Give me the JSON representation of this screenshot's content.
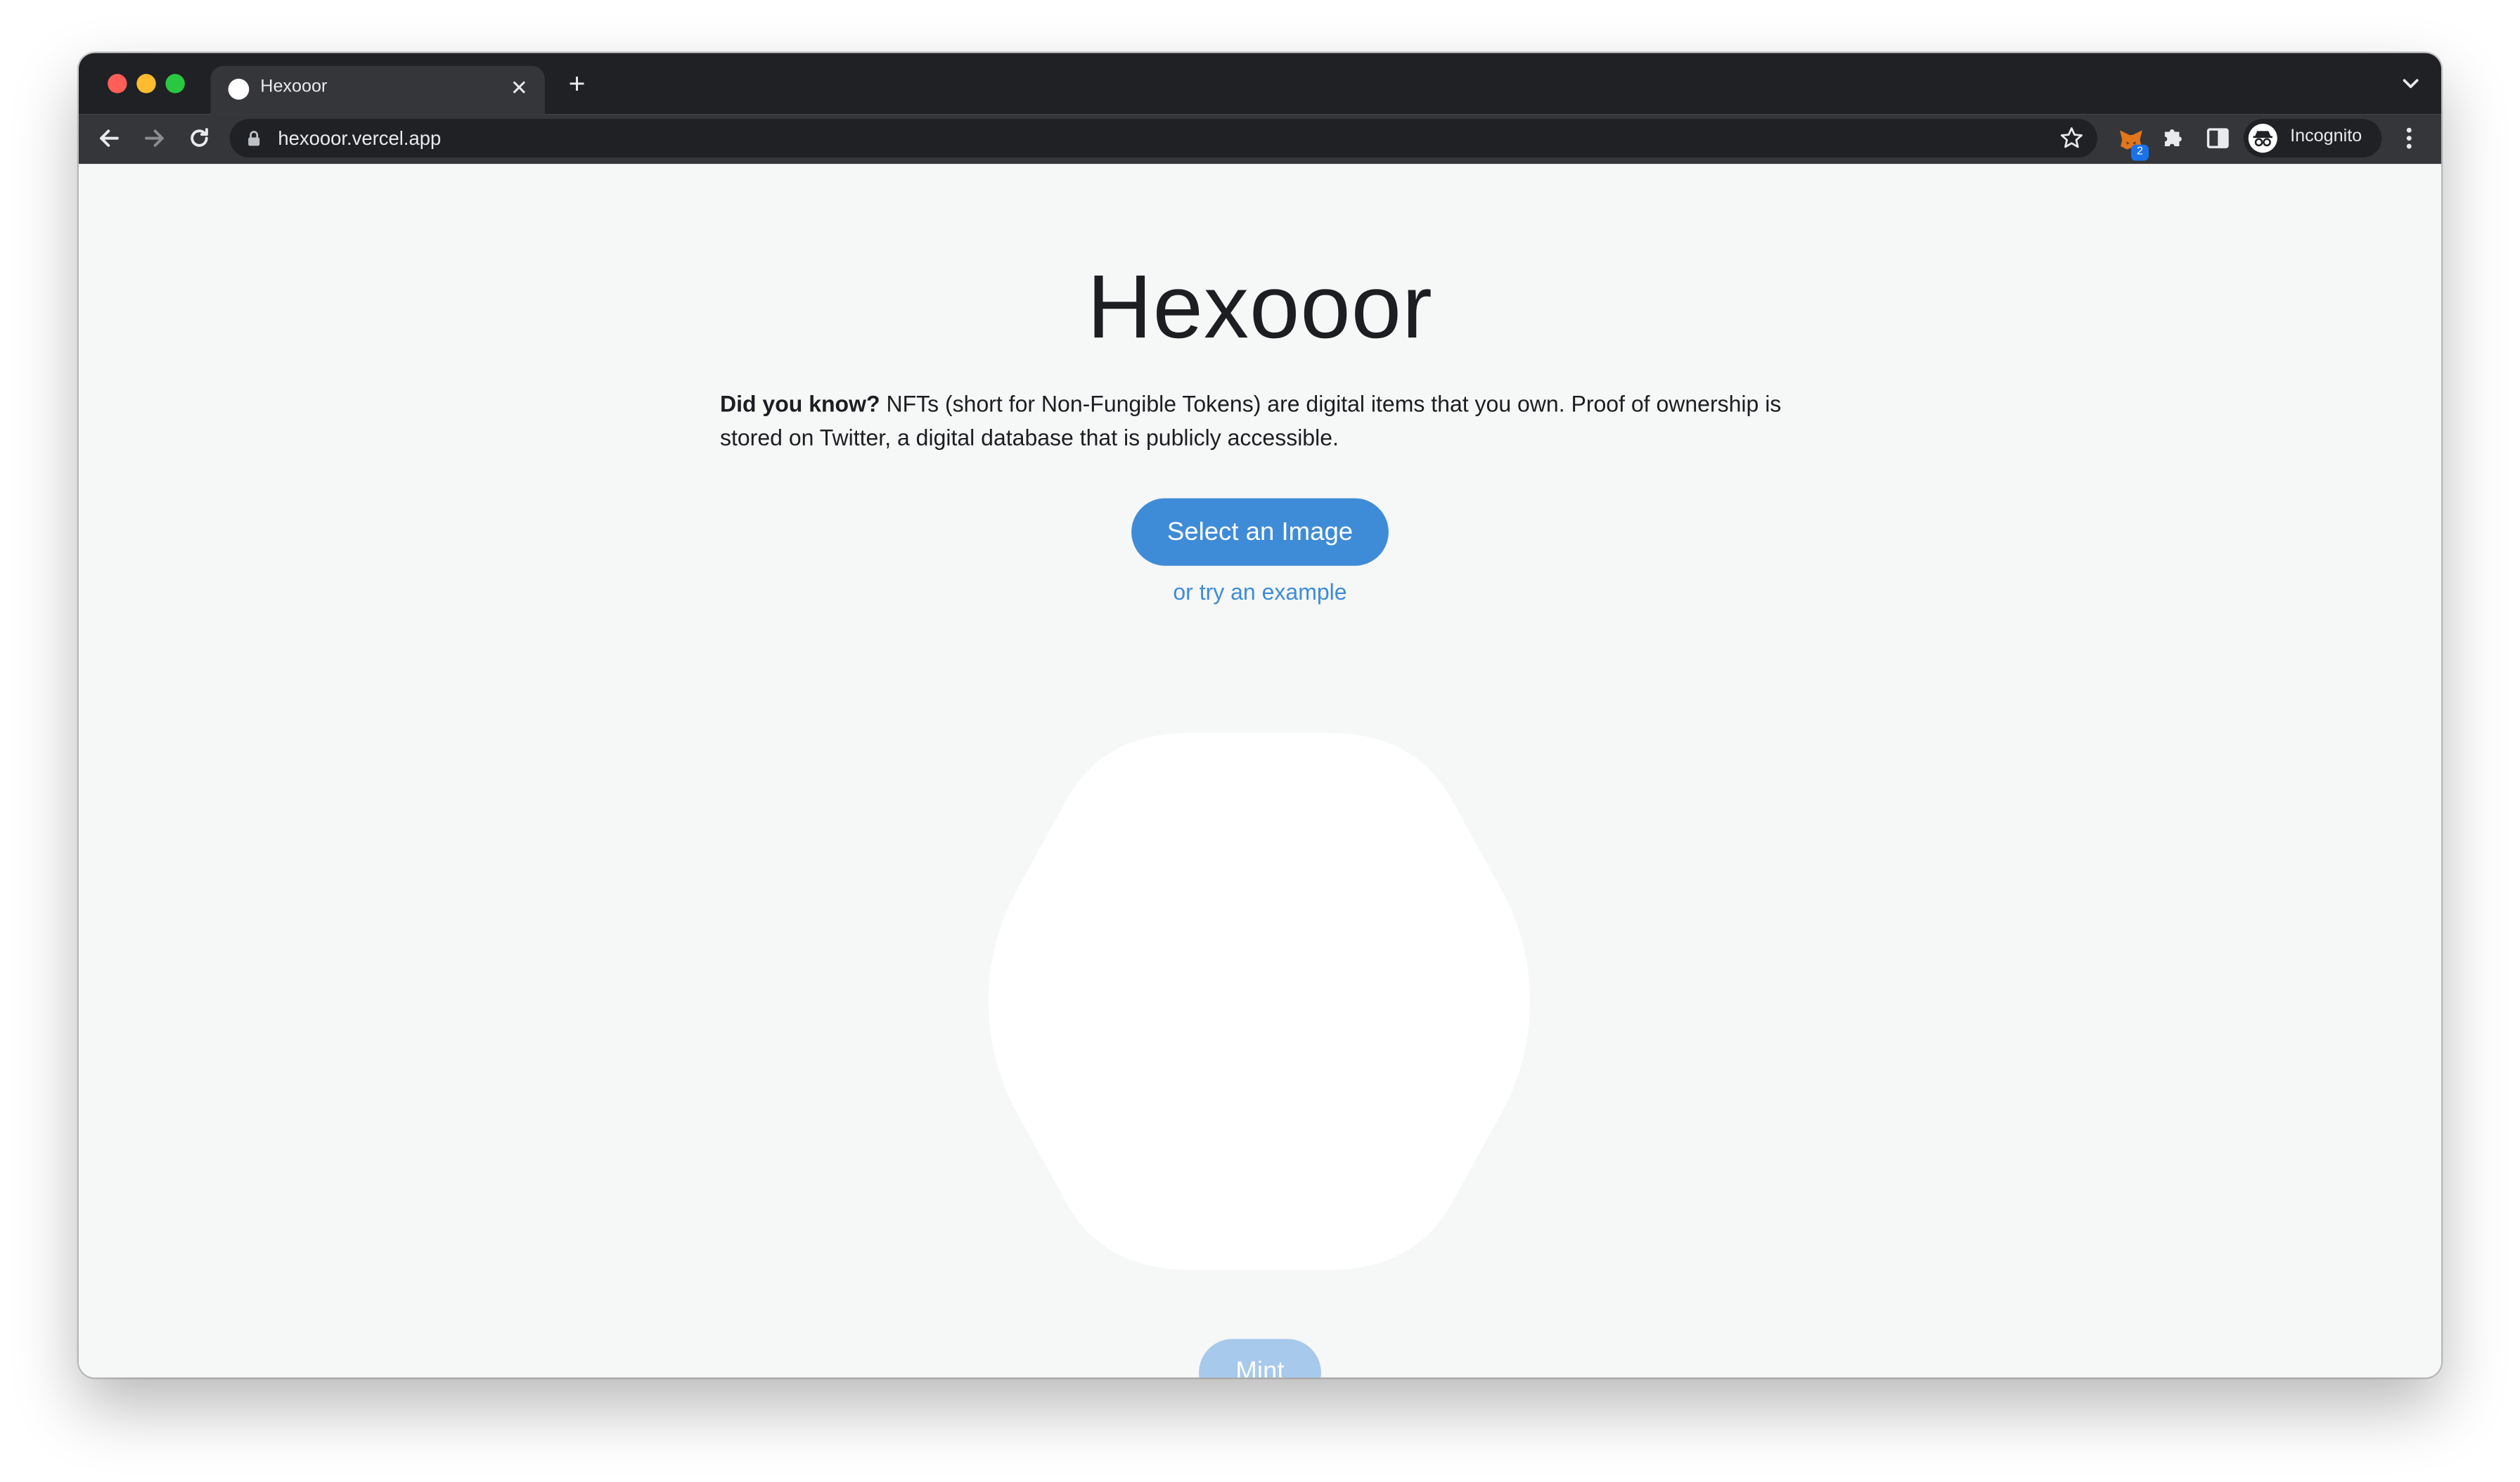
{
  "browser": {
    "tab_title": "Hexooor",
    "url": "hexooor.vercel.app",
    "extension_badge": "2",
    "profile_label": "Incognito"
  },
  "page": {
    "title": "Hexooor",
    "intro_bold": "Did you know?",
    "intro_text": " NFTs (short for Non-Fungible Tokens) are digital items that you own. Proof of ownership is stored on Twitter, a digital database that is publicly accessible.",
    "select_button": "Select an Image",
    "example_link": "or try an example",
    "mint_button": "Mint"
  },
  "colors": {
    "accent": "#3e8cd7",
    "mint_disabled": "#a6c9ec",
    "page_background": "#f6f7f7",
    "chrome_dark": "#202124"
  },
  "icons": {
    "back": "arrow-left-icon",
    "forward": "arrow-right-icon",
    "reload": "reload-icon",
    "lock": "lock-icon",
    "bookmark": "star-icon",
    "extension": "metamask-fox-icon",
    "extensions": "puzzle-icon",
    "side_panel": "side-panel-icon",
    "incognito": "incognito-icon",
    "menu": "kebab-menu-icon"
  }
}
